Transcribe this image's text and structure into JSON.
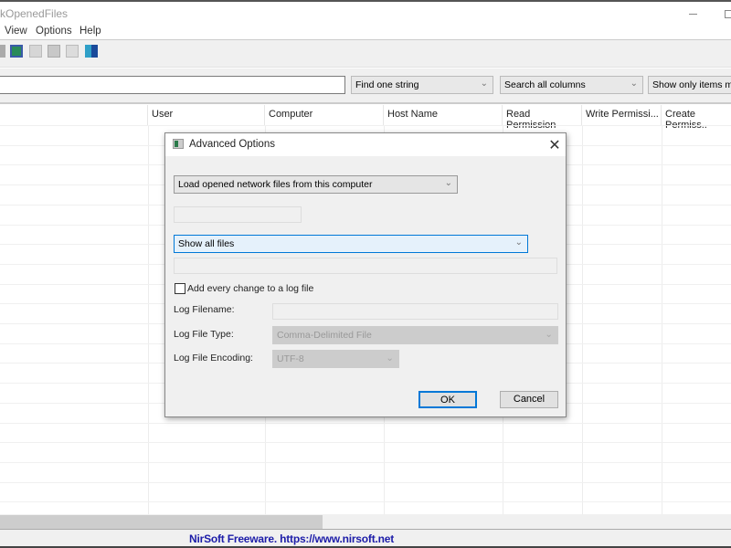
{
  "window": {
    "title": "kOpenedFiles"
  },
  "menu": [
    "View",
    "Options",
    "Help"
  ],
  "toolbar": {
    "icons": [
      "save-icon",
      "refresh-icon",
      "copy-icon",
      "properties-icon",
      "report-icon",
      "exit-icon"
    ]
  },
  "filter": {
    "text_value": "",
    "mode": "Find one string",
    "columns": "Search all columns",
    "show": "Show only items matc"
  },
  "columns": [
    "User",
    "Computer",
    "Host Name",
    "Read Permission",
    "Write Permissi...",
    "Create Permiss.."
  ],
  "status": "NirSoft Freeware. https://www.nirsoft.net",
  "dialog": {
    "title": "Advanced Options",
    "load_source": "Load opened network files from this computer",
    "computer_field": "",
    "file_filter": "Show all files",
    "filter_field": "",
    "log_checkbox_label": "Add every change to a log file",
    "log_checked": false,
    "log_filename_label": "Log Filename:",
    "log_filename": "",
    "log_type_label": "Log File Type:",
    "log_type": "Comma-Delimited File",
    "log_encoding_label": "Log File Encoding:",
    "log_encoding": "UTF-8",
    "ok": "OK",
    "cancel": "Cancel"
  },
  "colors": {
    "status_text": "#1c1ca8",
    "focus": "#0078d7"
  }
}
